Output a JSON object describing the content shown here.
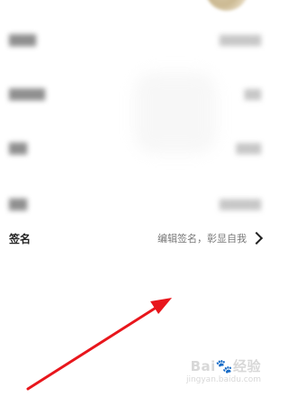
{
  "profile": {
    "signature_row": {
      "label": "签名",
      "value": "编辑签名，彰显自我"
    }
  },
  "watermark": {
    "main": "Bai🐾经验",
    "sub": "jingyan.baidu.com"
  },
  "colors": {
    "annotation_arrow": "#e8161c"
  },
  "icons": {
    "signature_chevron": "chevron-right-icon"
  }
}
